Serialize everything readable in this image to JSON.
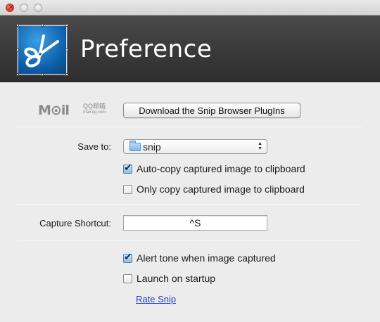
{
  "window": {
    "title": ""
  },
  "header": {
    "title": "Preference",
    "app_icon": "scissors-icon"
  },
  "plugins": {
    "mail_logo_text": "M⊙il",
    "mail_logo_cn": "QQ邮箱",
    "mail_logo_domain": "mail.qq.com",
    "download_button": "Download the Snip Browser PlugIns"
  },
  "save": {
    "label": "Save to:",
    "folder_value": "snip",
    "auto_copy_label": "Auto-copy captured image to clipboard",
    "auto_copy_checked": true,
    "only_copy_label": "Only copy captured image to clipboard",
    "only_copy_checked": false
  },
  "capture": {
    "label": "Capture Shortcut:",
    "shortcut_value": "^S"
  },
  "options": {
    "alert_label": "Alert tone when image captured",
    "alert_checked": true,
    "launch_label": "Launch on startup",
    "launch_checked": false,
    "rate_link": "Rate Snip"
  },
  "colors": {
    "header_bg": "#383838",
    "link": "#1a3fc7",
    "icon_blue": "#0d5ea8"
  }
}
